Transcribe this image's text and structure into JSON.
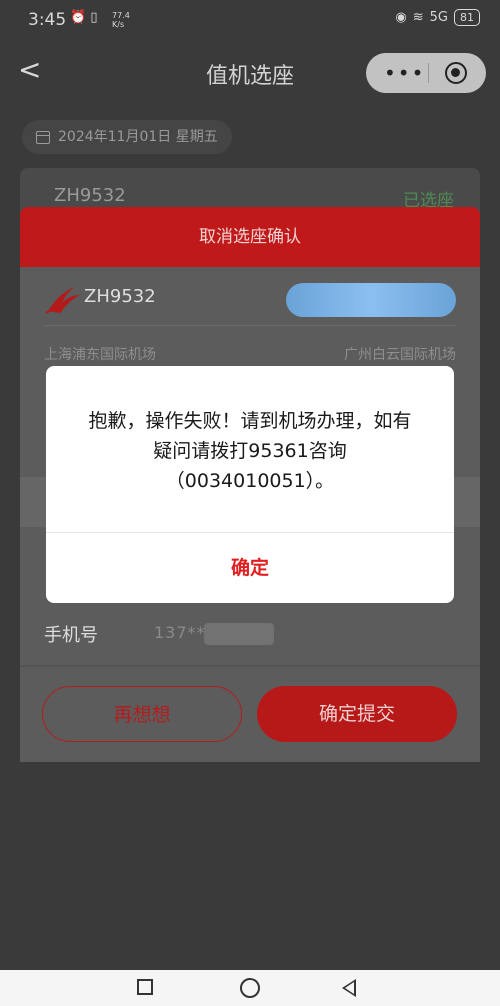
{
  "status_bar": {
    "time": "3:45",
    "net_speed_value": "77.4",
    "net_speed_unit": "K/s",
    "network": "5G",
    "battery": "81"
  },
  "nav": {
    "back": "<",
    "title": "值机选座",
    "more": "•••"
  },
  "date": {
    "text": "2024年11月01日  星期五"
  },
  "background_card": {
    "flight_no": "ZH9532",
    "status": "已选座"
  },
  "sheet": {
    "title": "取消选座确认",
    "flight_no": "ZH9532",
    "departure": "上海浦东国际机场",
    "arrival": "广州白云国际机场",
    "phone_label": "手机号",
    "phone_value": "137**",
    "rethink_label": "再想想",
    "submit_label": "确定提交"
  },
  "alert": {
    "message": "抱歉，操作失败！请到机场办理，如有疑问请拨打95361咨询（0034010051）。",
    "ok_label": "确定"
  },
  "colors": {
    "brand_red": "#e02020",
    "status_green": "#4f8a55"
  }
}
